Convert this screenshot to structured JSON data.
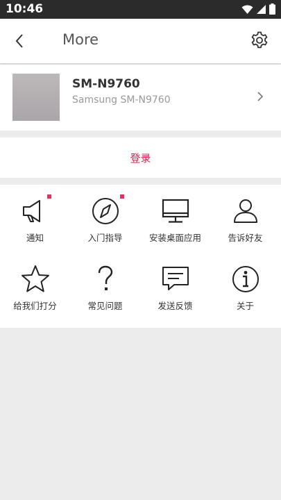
{
  "status_bar": {
    "time": "10:46"
  },
  "app_bar": {
    "title": "More"
  },
  "device": {
    "name": "SM-N9760",
    "model": "Samsung SM-N9760"
  },
  "login": {
    "label": "登录"
  },
  "grid": [
    {
      "label": "通知",
      "icon": "megaphone-icon",
      "badge": true
    },
    {
      "label": "入门指导",
      "icon": "compass-icon",
      "badge": true
    },
    {
      "label": "安装桌面应用",
      "icon": "desktop-monitor-icon",
      "badge": false
    },
    {
      "label": "告诉好友",
      "icon": "person-icon",
      "badge": false
    },
    {
      "label": "给我们打分",
      "icon": "star-icon",
      "badge": false
    },
    {
      "label": "常见问题",
      "icon": "question-mark-icon",
      "badge": false
    },
    {
      "label": "发送反馈",
      "icon": "chat-bubble-icon",
      "badge": false
    },
    {
      "label": "关于",
      "icon": "info-icon",
      "badge": false
    }
  ],
  "colors": {
    "accent": "#d8284f",
    "badge": "#e2345b",
    "status_bar": "#2b2b2b"
  }
}
